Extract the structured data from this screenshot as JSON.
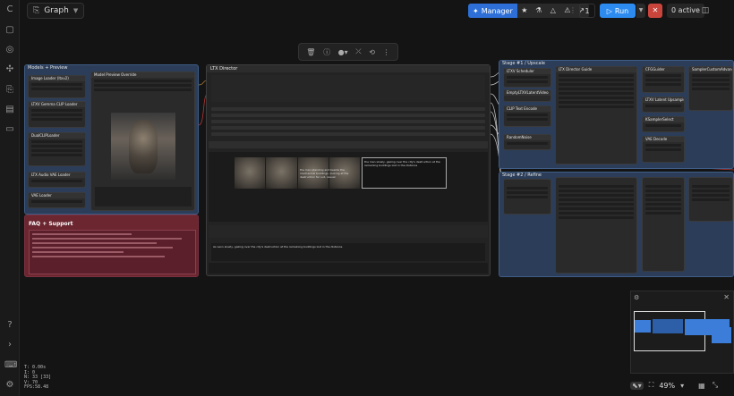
{
  "topbar": {
    "graph_label": "Graph",
    "manager_label": "Manager",
    "queue_count": "1",
    "run_label": "Run",
    "active_label": "0 active"
  },
  "canvas": {
    "groups": {
      "models_preview": "Models + Preview",
      "faq": "FAQ + Support",
      "stage1": "Stage #1 / Upscale",
      "stage2": "Stage #2 / Refine"
    },
    "nodes": {
      "ltx_director": "LTX Director",
      "image_loader": "Image Loader (ltxv2)",
      "video_preview": "Model Preview Override",
      "ltxv_scheduler": "LTXV Scheduler",
      "sampler_custom": "SamplerCustomAdvanced",
      "vae_decode": "VAE Decode",
      "ltx_director_guide": "LTX Director Guide",
      "empty_latent": "EmptyLTXVLatentVideo",
      "random_noise": "RandomNoise",
      "cfg_guider": "CFGGuider",
      "ksampler_select": "KSamplerSelect",
      "text_encode": "CLIP Text Encode",
      "upscaler": "LTXV Latent Upsampler",
      "audio_vae": "LTX Audio VAE Loader",
      "clip_loader": "DualCLIPLoader",
      "gemma_loader": "LTXV Gemma CLIP Loader",
      "vae_loader": "VAE Loader"
    },
    "director_prompt": "As Leon slowly, gazing over the city's destruction at the remaining buildings lost in the distance.",
    "director_caption_a": "the man standing and beside the mechanical buildings, looking at the destruction far out, casual",
    "director_caption_b": "the man slowly, gazing over the city's destruction at the remaining buildings lost in the distance"
  },
  "minimap": {
    "zoom_label": "49%"
  },
  "stats": {
    "lines": [
      "T: 0.00s",
      "I: 0",
      "N: 33 [33]",
      "V: 70",
      "FPS:58.48"
    ]
  },
  "colors": {
    "accent_blue": "#2d8bf0",
    "manager_blue": "#2d6fd6",
    "stop_red": "#c9453c",
    "faq_red": "#6b2630",
    "group_blue": "#3f5d86"
  }
}
